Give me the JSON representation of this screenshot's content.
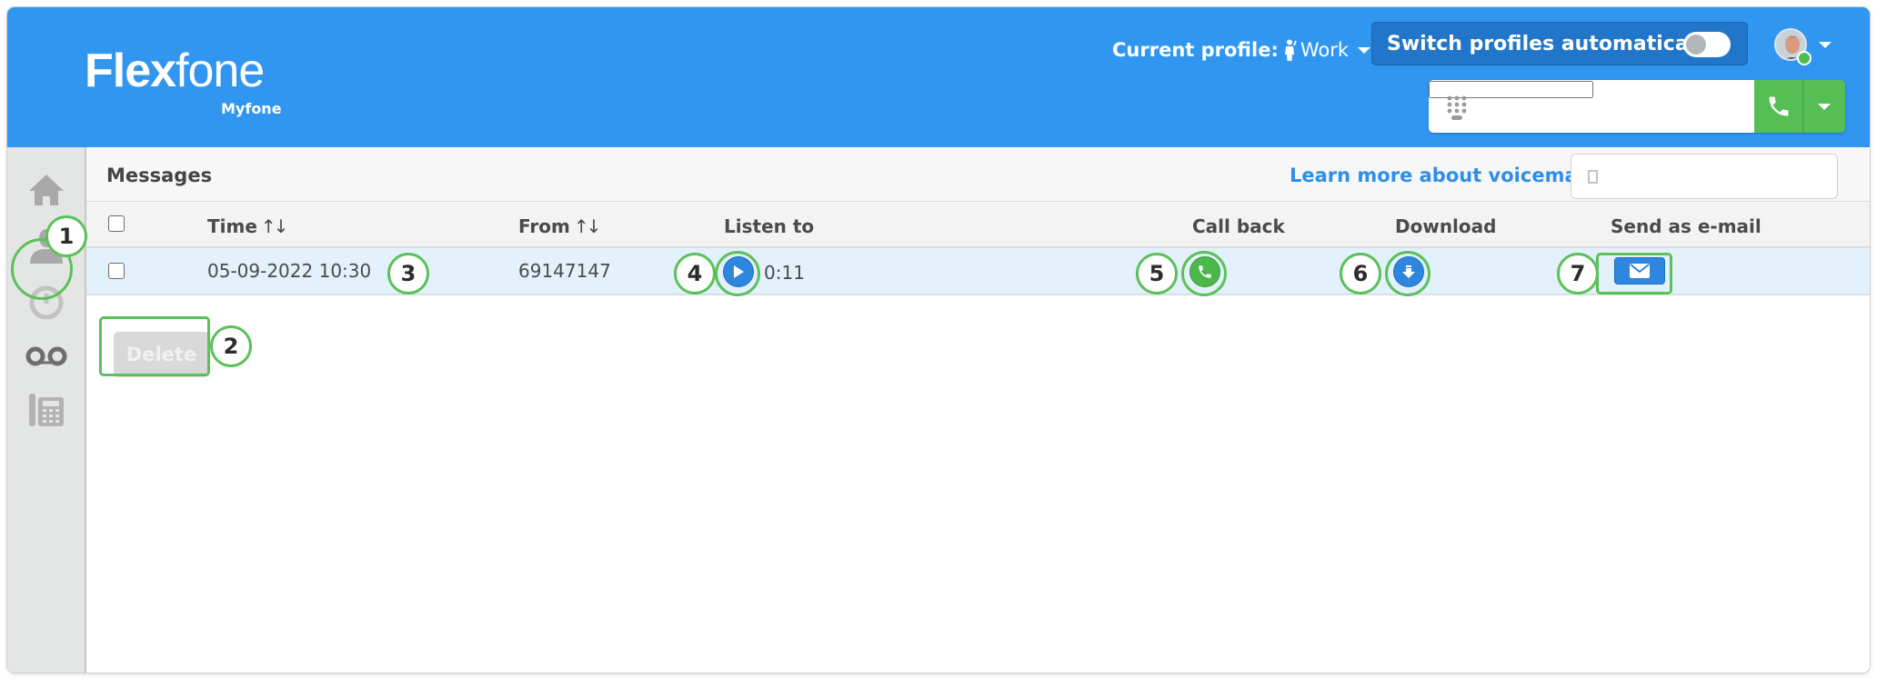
{
  "app": {
    "brand": "Flexfone",
    "brand_bold": "Flex",
    "brand_thin": "fone",
    "sub_brand": "Myfone"
  },
  "header": {
    "current_profile_label": "Current profile:",
    "current_profile_value": "Work",
    "switch_profiles_label": "Switch profiles automatically",
    "switch_profiles_on": false,
    "dialer_placeholder": "",
    "icons": {
      "profile": "person-icon",
      "keypad": "keypad-icon",
      "call": "phone-icon",
      "dropdown": "chevron-down-icon",
      "avatar_status": "online"
    }
  },
  "sidebar": {
    "items": [
      {
        "name": "home",
        "icon": "home-icon",
        "active": false
      },
      {
        "name": "contacts",
        "icon": "user-icon",
        "active": false
      },
      {
        "name": "history",
        "icon": "clock-icon",
        "active": false
      },
      {
        "name": "voicemail",
        "icon": "voicemail-icon",
        "active": true
      },
      {
        "name": "phones",
        "icon": "desk-phone-icon",
        "active": false
      }
    ]
  },
  "messages": {
    "title": "Messages",
    "learn_more": "Learn more about voicemail",
    "search_placeholder": "",
    "columns": {
      "time": "Time",
      "from": "From",
      "listen": "Listen to",
      "call_back": "Call back",
      "download": "Download",
      "send_email": "Send as e-mail",
      "sort_glyph": "↑↓"
    },
    "rows": [
      {
        "time": "05-09-2022 10:30",
        "from": "69147147",
        "duration": "0:11",
        "selected": false
      }
    ],
    "delete_label": "Delete"
  },
  "annotations": [
    "1",
    "2",
    "3",
    "4",
    "5",
    "6",
    "7"
  ],
  "colors": {
    "header_blue": "#3096f0",
    "switch_box": "#2176c9",
    "link_blue": "#2f8fe5",
    "call_green": "#55be55",
    "annotation_green": "#5cc15a",
    "row_highlight": "#e3f1fc",
    "sidebar_bg": "#e4e5e5"
  }
}
